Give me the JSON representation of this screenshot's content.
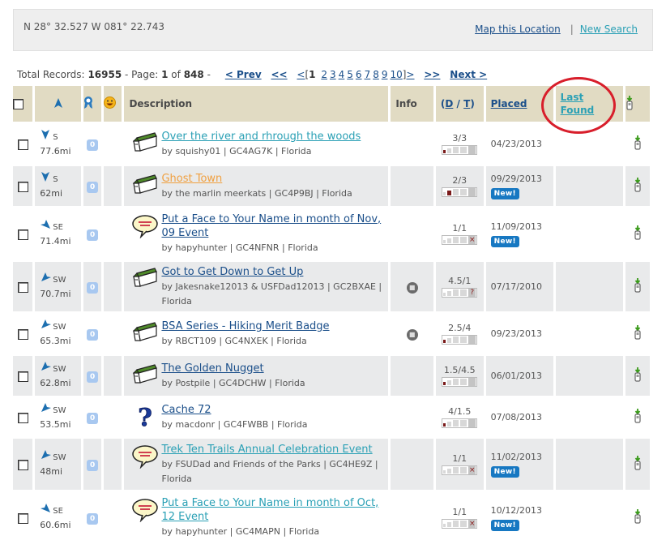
{
  "header": {
    "coordinates": "N 28° 32.527 W 081° 22.743",
    "map_link": "Map this Location",
    "separator": "|",
    "new_search": "New Search"
  },
  "pager": {
    "total_label": "Total Records:",
    "total": "16955",
    "page_label": "- Page:",
    "page": "1",
    "of_label": "of",
    "pages": "848",
    "dash": "-",
    "prev": "< Prev",
    "first": "<<",
    "lt": "<",
    "lbracket": "[",
    "current": "1",
    "page_links": [
      "2",
      "3",
      "4",
      "5",
      "6",
      "7",
      "8",
      "9",
      "10"
    ],
    "rbracket": "]",
    "gt": ">",
    "last": ">>",
    "next": "Next >"
  },
  "columns": {
    "description": "Description",
    "info": "Info",
    "dt_open": "(",
    "d": "D",
    "slash": " / ",
    "t": "T",
    "dt_close": ")",
    "placed": "Placed",
    "last_found_1": "Last",
    "last_found_2": "Found"
  },
  "annotation": {
    "color": "#d81e2b",
    "target": "Last Found"
  },
  "rows": [
    {
      "dir": "S",
      "dist": "77.6mi",
      "fav": "0",
      "type": "traditional",
      "title": "Over the river and rhrough the woods",
      "title_style": "teal",
      "by": "by squishy01 | GC4AG7K | Florida",
      "info": "",
      "dt": "3/3",
      "d_level": 1,
      "terrain_mark": "",
      "placed": "04/23/2013",
      "new": false,
      "new_label": ""
    },
    {
      "dir": "S",
      "dist": "62mi",
      "fav": "0",
      "type": "traditional",
      "title": "Ghost Town",
      "title_style": "orange",
      "by": "by the marlin meerkats | GC4P9BJ | Florida",
      "info": "",
      "dt": "2/3",
      "d_level": 2,
      "terrain_mark": "",
      "placed": "09/29/2013",
      "new": true,
      "new_label": "New!"
    },
    {
      "dir": "SE",
      "dist": "71.4mi",
      "fav": "0",
      "type": "event",
      "title": "Put a Face to Your Name in month of Nov, 09 Event",
      "title_style": "blue",
      "by": "by hapyhunter | GC4NFNR | Florida",
      "info": "",
      "dt": "1/1",
      "d_level": 0,
      "terrain_mark": "×",
      "placed": "11/09/2013",
      "new": true,
      "new_label": "New!"
    },
    {
      "dir": "SW",
      "dist": "70.7mi",
      "fav": "0",
      "type": "traditional",
      "title": "Got to Get Down to Get Up",
      "title_style": "blue",
      "by": "by Jakesnake12013 & USFDad12013 | GC2BXAE | Florida",
      "info": "travel-bug",
      "dt": "4.5/1",
      "d_level": 0,
      "terrain_mark": "?",
      "placed": "07/17/2010",
      "new": false,
      "new_label": ""
    },
    {
      "dir": "SW",
      "dist": "65.3mi",
      "fav": "0",
      "type": "traditional",
      "title": "BSA Series - Hiking Merit Badge",
      "title_style": "blue",
      "by": "by RBCT109 | GC4NXEK | Florida",
      "info": "travel-bug",
      "dt": "2.5/4",
      "d_level": 1,
      "terrain_mark": "",
      "placed": "09/23/2013",
      "new": false,
      "new_label": ""
    },
    {
      "dir": "SW",
      "dist": "62.8mi",
      "fav": "0",
      "type": "traditional",
      "title": "The Golden Nugget",
      "title_style": "blue",
      "by": "by Postpile | GC4DCHW | Florida",
      "info": "",
      "dt": "1.5/4.5",
      "d_level": 1,
      "terrain_mark": "",
      "placed": "06/01/2013",
      "new": false,
      "new_label": ""
    },
    {
      "dir": "SW",
      "dist": "53.5mi",
      "fav": "0",
      "type": "mystery",
      "title": "Cache 72",
      "title_style": "blue",
      "by": "by macdonr | GC4FWBB | Florida",
      "info": "",
      "dt": "4/1.5",
      "d_level": 1,
      "terrain_mark": "",
      "placed": "07/08/2013",
      "new": false,
      "new_label": ""
    },
    {
      "dir": "SW",
      "dist": "48mi",
      "fav": "0",
      "type": "event",
      "title": "Trek Ten Trails Annual Celebration Event",
      "title_style": "teal",
      "by": "by FSUDad and Friends of the Parks | GC4HE9Z | Florida",
      "info": "",
      "dt": "1/1",
      "d_level": 0,
      "terrain_mark": "×",
      "placed": "11/02/2013",
      "new": true,
      "new_label": "New!"
    },
    {
      "dir": "SE",
      "dist": "60.6mi",
      "fav": "0",
      "type": "event",
      "title": "Put a Face to Your Name in month of Oct, 12 Event",
      "title_style": "teal",
      "by": "by hapyhunter | GC4MAPN | Florida",
      "info": "",
      "dt": "1/1",
      "d_level": 0,
      "terrain_mark": "×",
      "placed": "10/12/2013",
      "new": true,
      "new_label": "New!"
    }
  ]
}
